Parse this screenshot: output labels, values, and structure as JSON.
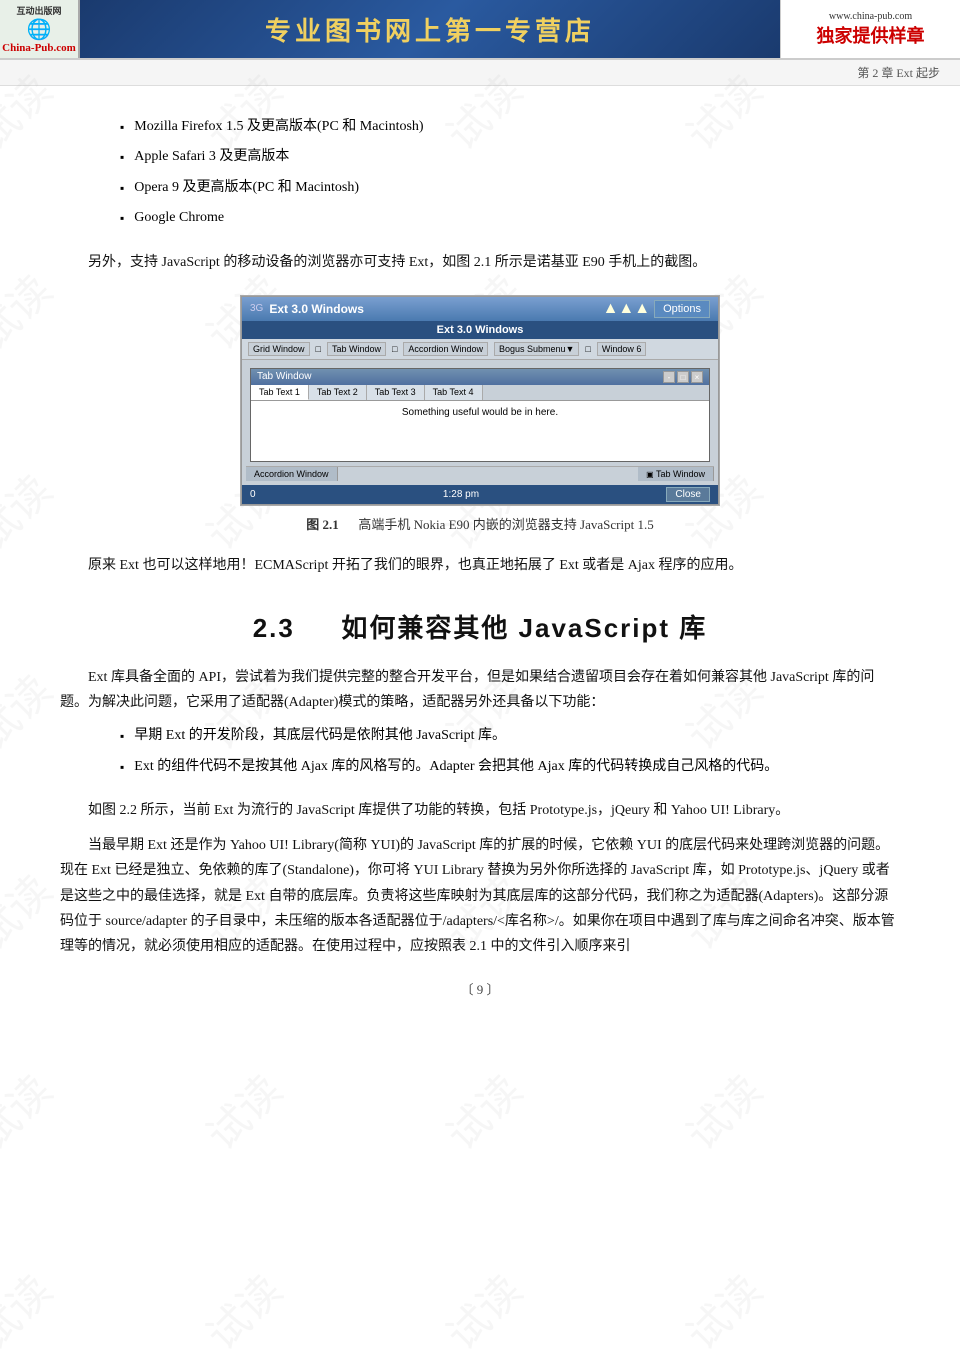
{
  "header": {
    "logo_top": "互动出版网",
    "logo_site": "China-Pub.com",
    "logo_icon": "🌐",
    "center_title": "专业图书网上第一专营店",
    "right_www": "www.china-pub.com",
    "right_exclusive": "独家提供样章"
  },
  "chapter_bar": {
    "text": "第 2 章   Ext 起步"
  },
  "watermark_text": "试读",
  "bullet_items": [
    "Mozilla Firefox 1.5 及更高版本(PC 和 Macintosh)",
    "Apple Safari 3 及更高版本",
    "Opera 9 及更高版本(PC 和 Macintosh)",
    "Google Chrome"
  ],
  "para1": "另外，支持 JavaScript 的移动设备的浏览器亦可支持 Ext，如图 2.1 所示是诺基亚 E90 手机上的截图。",
  "figure": {
    "titlebar_signal": "3G",
    "titlebar_title": "Ext 3.0 Windows",
    "titlebar_right": "Options",
    "menubar_text": "Ext 3.0 Windows",
    "toolbar_items": [
      "Grid Window",
      "Tab Window",
      "Accordion Window",
      "Bogus Submenu▼",
      "Window 6"
    ],
    "inner_title": "Tab Window",
    "inner_controls": [
      "-",
      "□",
      "×"
    ],
    "tabs": [
      "Tab Text 1",
      "Tab Text 2",
      "Tab Text 3",
      "Tab Text 4"
    ],
    "content_text": "Something useful would be in here.",
    "accordion_items": [
      "Accordion Window",
      "Tab Window"
    ],
    "statusbar_left": "0",
    "statusbar_time": "1:28 pm",
    "statusbar_close": "Close",
    "caption_num": "图 2.1",
    "caption_text": "高端手机 Nokia E90 内嵌的浏览器支持 JavaScript 1.5"
  },
  "para2": "原来 Ext 也可以这样地用！ECMAScript 开拓了我们的眼界，也真正地拓展了 Ext 或者是 Ajax 程序的应用。",
  "section": {
    "number": "2.3",
    "title": "如何兼容其他 JavaScript 库"
  },
  "para3": "Ext 库具备全面的 API，尝试着为我们提供完整的整合开发平台，但是如果结合遗留项目会存在着如何兼容其他 JavaScript 库的问题。为解决此问题，它采用了适配器(Adapter)模式的策略，适配器另外还具备以下功能：",
  "bullet2_items": [
    "早期 Ext 的开发阶段，其底层代码是依附其他 JavaScript 库。",
    "Ext 的组件代码不是按其他 Ajax 库的风格写的。Adapter 会把其他 Ajax 库的代码转换成自己风格的代码。"
  ],
  "para4": "如图 2.2 所示，当前 Ext 为流行的 JavaScript 库提供了功能的转换，包括 Prototype.js，jQeury 和 Yahoo UI! Library。",
  "para5": "当最早期 Ext 还是作为 Yahoo UI! Library(简称 YUI)的 JavaScript 库的扩展的时候，它依赖 YUI 的底层代码来处理跨浏览器的问题。现在 Ext 已经是独立、免依赖的库了(Standalone)，你可将 YUI  Library 替换为另外你所选择的 JavaScript 库，如 Prototype.js、jQuery 或者是这些之中的最佳选择，就是 Ext 自带的底层库。负责将这些库映射为其底层库的这部分代码，我们称之为适配器(Adapters)。这部分源码位于 source/adapter 的子目录中，未压缩的版本各适配器位于/adapters/<库名称>/。如果你在项目中遇到了库与库之间命名冲突、版本管理等的情况，就必须使用相应的适配器。在使用过程中，应按照表 2.1 中的文件引入顺序来引",
  "page_number": "〔 9 〕"
}
